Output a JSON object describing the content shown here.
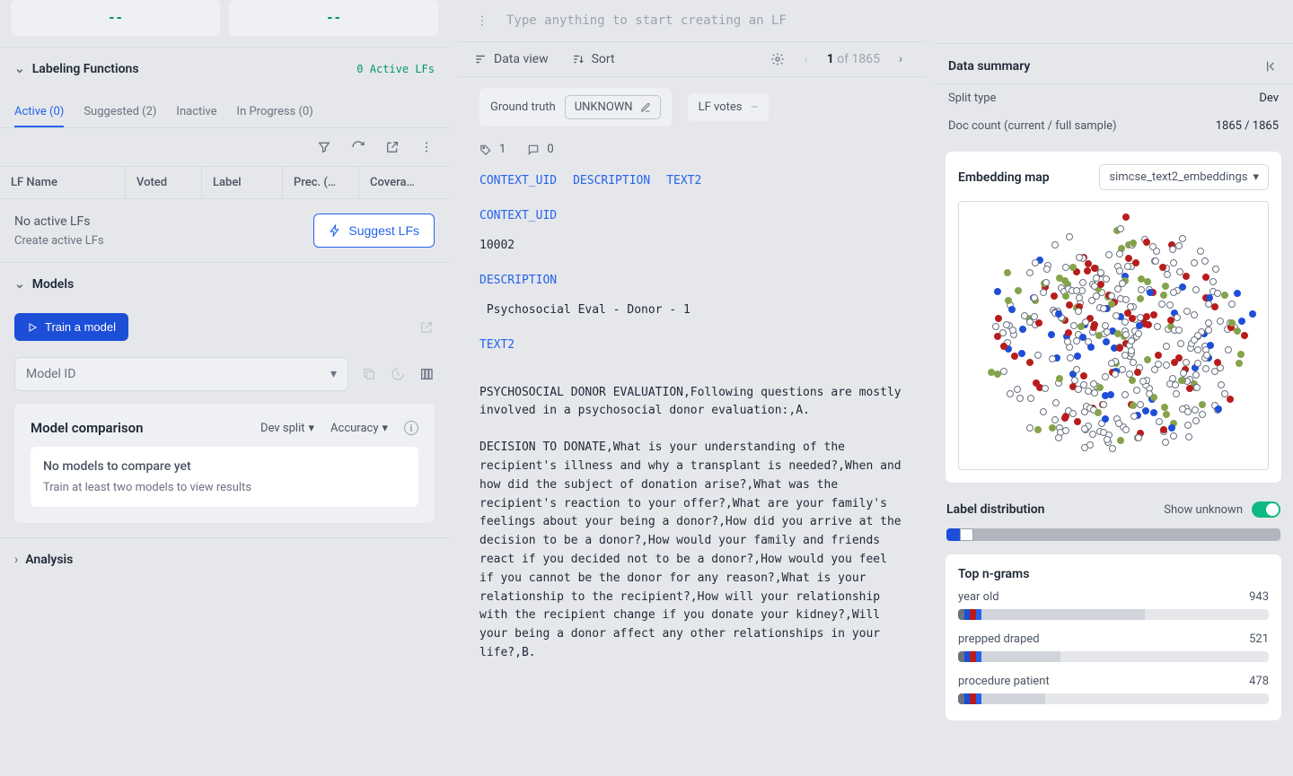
{
  "top_metrics": [
    "--",
    "--"
  ],
  "lf_input_placeholder": "Type anything to start creating an LF",
  "labeling_functions": {
    "title": "Labeling Functions",
    "active_badge": "0 Active LFs",
    "tabs": [
      "Active (0)",
      "Suggested (2)",
      "Inactive",
      "In Progress (0)"
    ],
    "columns": [
      "LF Name",
      "Voted",
      "Label",
      "Prec. (…",
      "Covera…"
    ],
    "empty_title": "No active LFs",
    "empty_sub": "Create active LFs",
    "suggest_btn": "Suggest LFs"
  },
  "models": {
    "title": "Models",
    "train_btn": "Train a model",
    "model_id_placeholder": "Model ID",
    "comparison_title": "Model comparison",
    "split_dd": "Dev split",
    "metric_dd": "Accuracy",
    "empty_title": "No models to compare yet",
    "empty_sub": "Train at least two models to view results"
  },
  "analysis": {
    "title": "Analysis"
  },
  "data_view": {
    "label": "Data view",
    "sort": "Sort",
    "current": "1",
    "of": "of 1865",
    "ground_truth": "Ground truth",
    "unknown": "UNKNOWN",
    "lf_votes": "LF votes",
    "lf_votes_val": "--",
    "tag_count": "1",
    "comment_count": "0",
    "fields": [
      "CONTEXT_UID",
      "DESCRIPTION",
      "TEXT2"
    ],
    "doc": {
      "context_uid_label": "CONTEXT_UID",
      "context_uid": "10002",
      "description_label": "DESCRIPTION",
      "description": " Psychosocial Eval - Donor - 1",
      "text2_label": "TEXT2",
      "text2_p1": "PSYCHOSOCIAL DONOR EVALUATION,Following questions are mostly involved in a psychosocial donor evaluation:,A.",
      "text2_p2": "DECISION TO DONATE,What is your understanding of the recipient's illness and why a transplant is needed?,When and how did the subject of donation arise?,What was the recipient's reaction to your offer?,What are your family's feelings about your being a donor?,How did you arrive at the decision to be a donor?,How would your family and friends react if you decided not to be a donor?,How would you feel if you cannot be the donor for any reason?,What is your relationship to the recipient?,How will your relationship with the recipient change if you donate your kidney?,Will your being a donor affect any other relationships in your life?,B."
    }
  },
  "summary": {
    "title": "Data summary",
    "split_type_label": "Split type",
    "split_type": "Dev",
    "doc_count_label": "Doc count (current / full sample)",
    "doc_count": "1865 / 1865",
    "embedding_title": "Embedding map",
    "embedding_select": "simcse_text2_embeddings",
    "dist_title": "Label distribution",
    "show_unknown": "Show unknown",
    "ngrams_title": "Top n-grams",
    "ngrams": [
      {
        "label": "year old",
        "count": "943",
        "pct": 60
      },
      {
        "label": "prepped draped",
        "count": "521",
        "pct": 33
      },
      {
        "label": "procedure patient",
        "count": "478",
        "pct": 28
      }
    ]
  }
}
